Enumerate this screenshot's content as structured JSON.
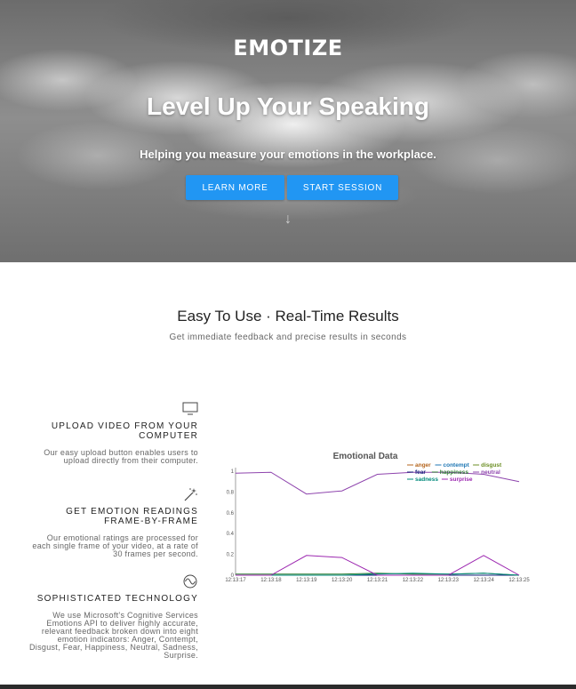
{
  "hero": {
    "brand": "EMOTIZE",
    "headline": "Level Up Your Speaking",
    "subheadline": "Helping you measure your emotions in the workplace.",
    "learn_more_label": "LEARN MORE",
    "start_session_label": "START SESSION",
    "scroll_arrow": "↓"
  },
  "section": {
    "title": "Easy To Use · Real-Time Results",
    "subtitle": "Get immediate feedback and precise results in seconds"
  },
  "features": [
    {
      "icon": "monitor-icon",
      "title": "UPLOAD VIDEO FROM YOUR COMPUTER",
      "desc": "Our easy upload button enables users to upload directly from their computer."
    },
    {
      "icon": "magic-wand-icon",
      "title": "GET EMOTION READINGS FRAME-BY-FRAME",
      "desc": "Our emotional ratings are processed for each single frame of your video, at a rate of 30 frames per second."
    },
    {
      "icon": "wave-icon",
      "title": "SOPHISTICATED TECHNOLOGY",
      "desc": "We use Microsoft's Cognitive Services Emotions API to deliver highly accurate, relevant feedback broken down into eight emotion indicators: Anger, Contempt, Disgust, Fear, Happiness, Neutral, Sadness, Surprise."
    }
  ],
  "chart_data": {
    "type": "line",
    "title": "Emotional Data",
    "xlabel": "",
    "ylabel": "",
    "x": [
      "12:13:17",
      "12:13:18",
      "12:13:19",
      "12:13:20",
      "12:13:21",
      "12:13:22",
      "12:13:23",
      "12:13:24",
      "12:13:25"
    ],
    "ylim": [
      0,
      1
    ],
    "y_ticks": [
      "0",
      "0.2",
      "0.4",
      "0.6",
      "0.8",
      "1"
    ],
    "legend_position": "top-right",
    "series": [
      {
        "name": "anger",
        "color": "#b5651d",
        "values": [
          0,
          0,
          0,
          0,
          0,
          0,
          0,
          0,
          0
        ]
      },
      {
        "name": "contempt",
        "color": "#1f77b4",
        "values": [
          0,
          0,
          0,
          0,
          0,
          0,
          0,
          0,
          0
        ]
      },
      {
        "name": "disgust",
        "color": "#6b8e23",
        "values": [
          0,
          0,
          0,
          0,
          0,
          0,
          0,
          0,
          0
        ]
      },
      {
        "name": "fear",
        "color": "#1a237e",
        "values": [
          0,
          0,
          0,
          0,
          0,
          0,
          0,
          0,
          0
        ]
      },
      {
        "name": "happiness",
        "color": "#2e7d32",
        "values": [
          0.01,
          0.01,
          0.01,
          0.01,
          0.02,
          0.01,
          0.01,
          0.02,
          0
        ]
      },
      {
        "name": "neutral",
        "color": "#8e44ad",
        "values": [
          0.98,
          0.99,
          0.78,
          0.81,
          0.97,
          0.99,
          0.99,
          0.97,
          0.9
        ]
      },
      {
        "name": "sadness",
        "color": "#00897b",
        "values": [
          0,
          0,
          0,
          0,
          0.01,
          0.02,
          0.01,
          0.02,
          0
        ]
      },
      {
        "name": "surprise",
        "color": "#9c27b0",
        "values": [
          0,
          0,
          0.19,
          0.17,
          0,
          0,
          0,
          0.19,
          0
        ]
      }
    ]
  }
}
